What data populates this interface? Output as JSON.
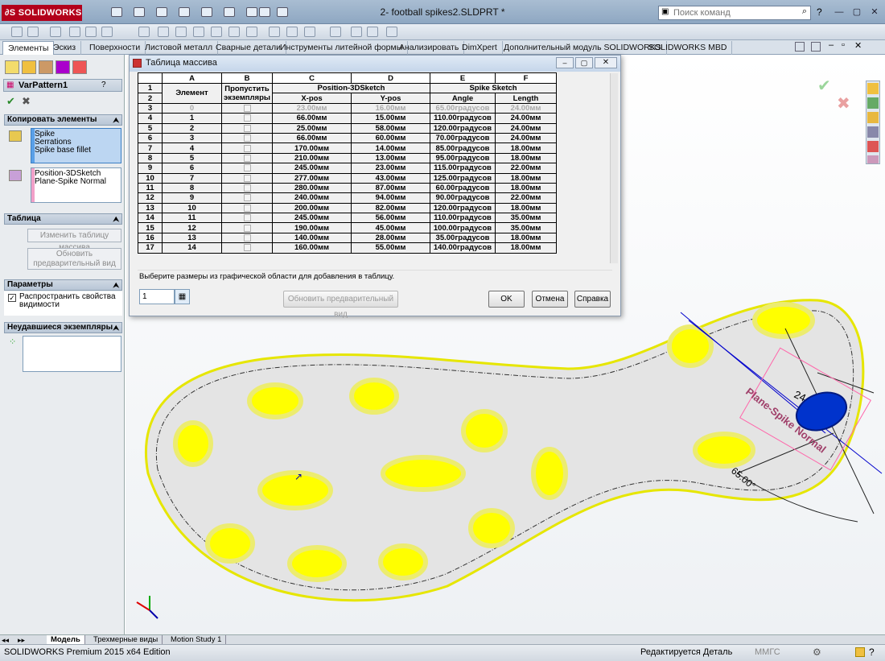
{
  "app": {
    "brand": "SOLIDWORKS",
    "doc_title": "2- football spikes2.SLDPRT *",
    "search_placeholder": "Поиск команд",
    "win_buttons": [
      "—",
      "▢",
      "✕"
    ]
  },
  "command_tabs": [
    "Элементы",
    "Эскиз",
    "Поверхности",
    "Листовой металл",
    "Сварные детали",
    "Инструменты литейной формы",
    "Анализировать",
    "DimXpert",
    "Дополнительный модуль SOLIDWORKS",
    "SOLIDWORKS MBD"
  ],
  "panel": {
    "feature_name": "VarPattern1",
    "copy_section": "Копировать элементы",
    "features": [
      "Spike",
      "Serrations",
      "Spike base fillet"
    ],
    "references": [
      "Position-3DSketch",
      "Plane-Spike Normal"
    ],
    "table_section": "Таблица",
    "edit_table_button": "Изменить таблицу массива",
    "update_preview_button": "Обновить предварительный вид",
    "params_section": "Параметры",
    "propagate_label": "Распространить свойства видимости",
    "failed_section": "Неудавшиеся экземпляры"
  },
  "dialog": {
    "title": "Таблица массива",
    "col_letters": [
      "A",
      "B",
      "C",
      "D",
      "E",
      "F"
    ],
    "group_headers": {
      "element": "Элемент",
      "skip": "Пропустить экземпляры",
      "position": "Position-3DSketch",
      "spike": "Spike Sketch"
    },
    "sub_headers": [
      "X-pos",
      "Y-pos",
      "Angle",
      "Length"
    ],
    "rows": [
      {
        "n": "3",
        "el": "0",
        "x": "23.00мм",
        "y": "16.00мм",
        "a": "65.00градусов",
        "l": "24.00мм"
      },
      {
        "n": "4",
        "el": "1",
        "x": "66.00мм",
        "y": "15.00мм",
        "a": "110.00градусов",
        "l": "24.00мм"
      },
      {
        "n": "5",
        "el": "2",
        "x": "25.00мм",
        "y": "58.00мм",
        "a": "120.00градусов",
        "l": "24.00мм"
      },
      {
        "n": "6",
        "el": "3",
        "x": "66.00мм",
        "y": "60.00мм",
        "a": "70.00градусов",
        "l": "24.00мм"
      },
      {
        "n": "7",
        "el": "4",
        "x": "170.00мм",
        "y": "14.00мм",
        "a": "85.00градусов",
        "l": "18.00мм"
      },
      {
        "n": "8",
        "el": "5",
        "x": "210.00мм",
        "y": "13.00мм",
        "a": "95.00градусов",
        "l": "18.00мм"
      },
      {
        "n": "9",
        "el": "6",
        "x": "245.00мм",
        "y": "23.00мм",
        "a": "115.00градусов",
        "l": "22.00мм"
      },
      {
        "n": "10",
        "el": "7",
        "x": "277.00мм",
        "y": "43.00мм",
        "a": "125.00градусов",
        "l": "18.00мм"
      },
      {
        "n": "11",
        "el": "8",
        "x": "280.00мм",
        "y": "87.00мм",
        "a": "60.00градусов",
        "l": "18.00мм"
      },
      {
        "n": "12",
        "el": "9",
        "x": "240.00мм",
        "y": "94.00мм",
        "a": "90.00градусов",
        "l": "22.00мм"
      },
      {
        "n": "13",
        "el": "10",
        "x": "200.00мм",
        "y": "82.00мм",
        "a": "120.00градусов",
        "l": "18.00мм"
      },
      {
        "n": "14",
        "el": "11",
        "x": "245.00мм",
        "y": "56.00мм",
        "a": "110.00градусов",
        "l": "35.00мм"
      },
      {
        "n": "15",
        "el": "12",
        "x": "190.00мм",
        "y": "45.00мм",
        "a": "100.00градусов",
        "l": "35.00мм"
      },
      {
        "n": "16",
        "el": "13",
        "x": "140.00мм",
        "y": "28.00мм",
        "a": "35.00градусов",
        "l": "18.00мм"
      },
      {
        "n": "17",
        "el": "14",
        "x": "160.00мм",
        "y": "55.00мм",
        "a": "140.00градусов",
        "l": "18.00мм"
      }
    ],
    "hint": "Выберите размеры из графической области для добавления в таблицу.",
    "count_value": "1",
    "update_preview_button": "Обновить предварительный вид",
    "ok_button": "OK",
    "cancel_button": "Отмена",
    "help_button": "Справка"
  },
  "viewport": {
    "plane_label": "Plane-Spike Normal",
    "dim_24": "24",
    "dim_65": "65.00°"
  },
  "bottom_tabs": [
    "Модель",
    "Трехмерные виды",
    "Motion Study 1"
  ],
  "status": {
    "edition": "SOLIDWORKS Premium 2015 x64 Edition",
    "editing": "Редактируется Деталь",
    "units": "ММГС"
  },
  "colors": {
    "accent": "#b3001b",
    "spike_yellow": "#ffff00",
    "sole_outline": "#e6e600",
    "selected_blue": "#0033cc"
  }
}
